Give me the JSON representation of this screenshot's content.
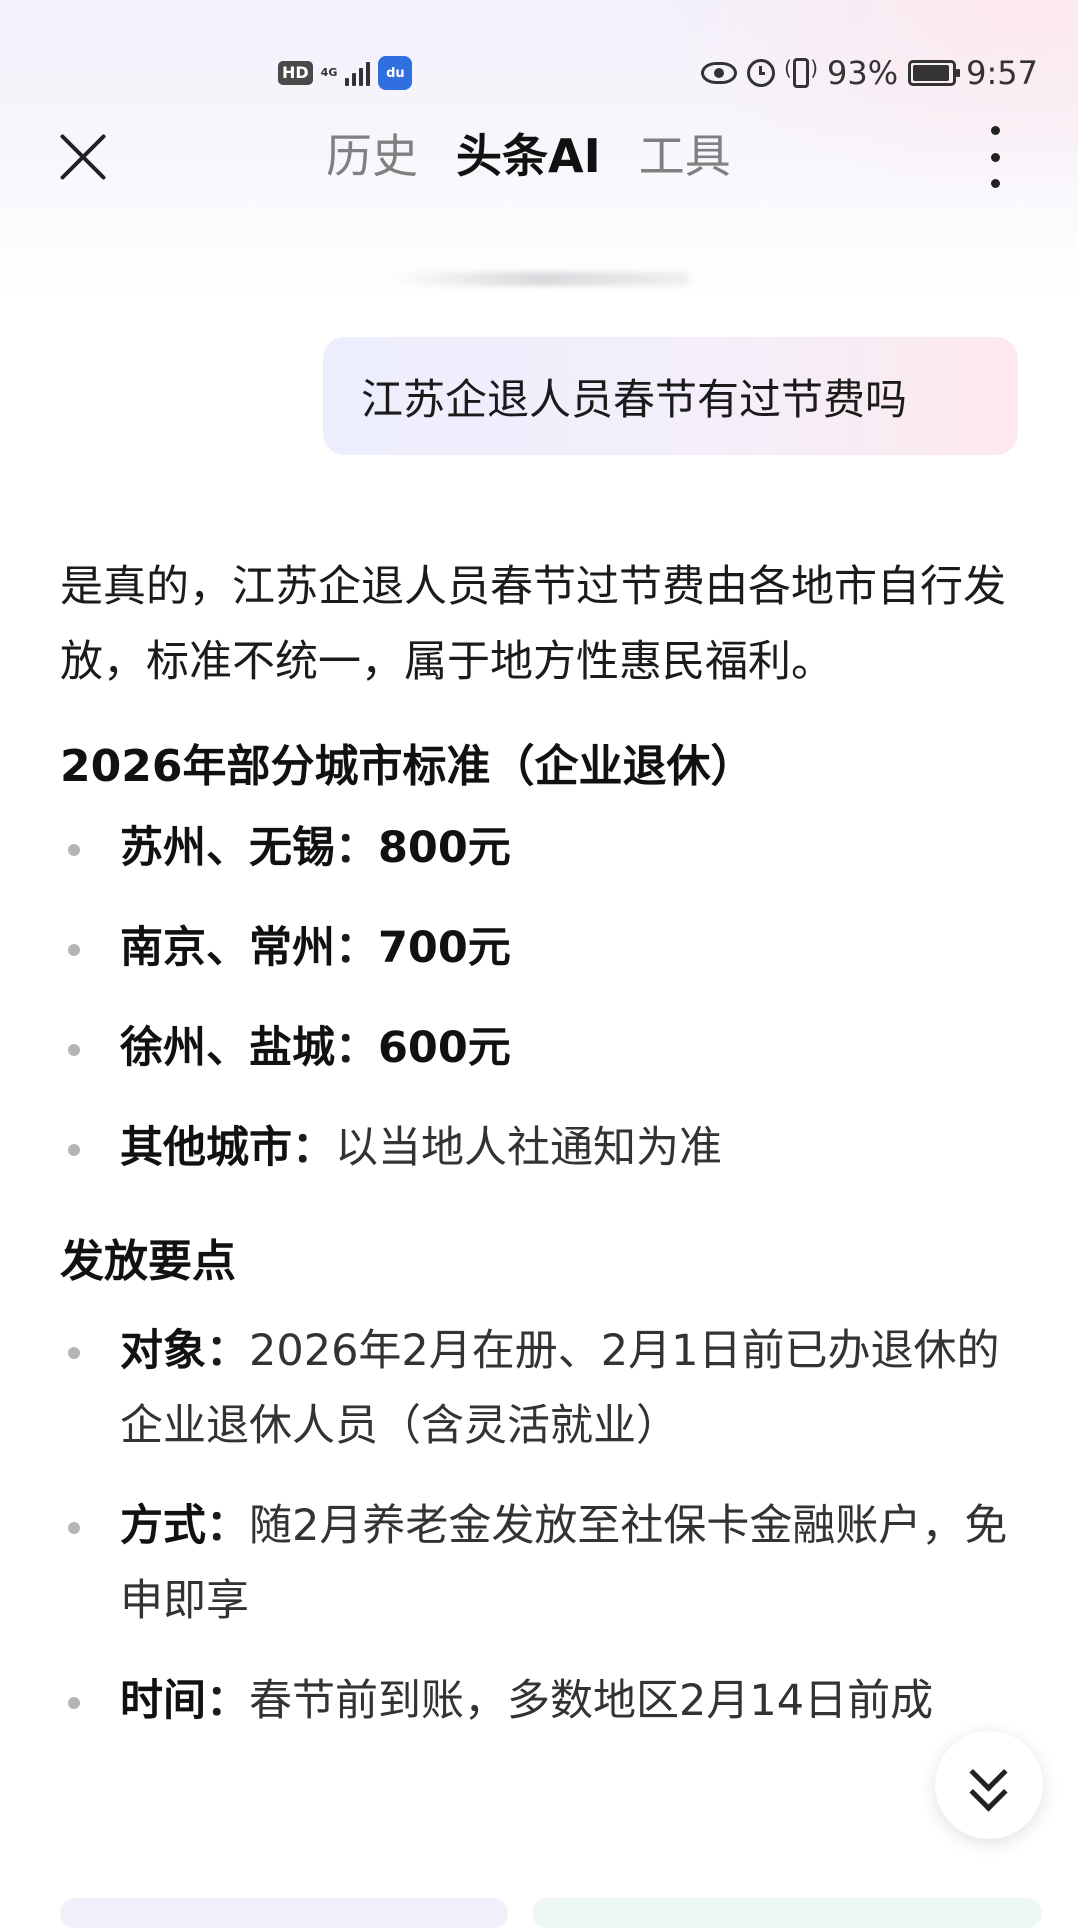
{
  "status_bar": {
    "hd": "HD",
    "network": "4G",
    "battery_percent": "93%",
    "time": "9:57",
    "icons": [
      "hd-icon",
      "signal-icon",
      "baidu-icon",
      "eye-icon",
      "alarm-icon",
      "vibrate-icon",
      "battery-icon"
    ]
  },
  "nav": {
    "tabs": [
      {
        "label": "历史",
        "active": false
      },
      {
        "label": "头条AI",
        "active": true
      },
      {
        "label": "工具",
        "active": false
      }
    ]
  },
  "chat": {
    "user_message": "江苏企退人员春节有过节费吗",
    "answer": {
      "intro": "是真的，江苏企退人员春节过节费由各地市自行发放，标准不统一，属于地方性惠民福利。",
      "section1_title": "2026年部分城市标准（企业退休）",
      "section1_items": [
        {
          "key": "苏州、无锡",
          "sep": "：",
          "value": "800元"
        },
        {
          "key": "南京、常州",
          "sep": "：",
          "value": "700元"
        },
        {
          "key": "徐州、盐城",
          "sep": "：",
          "value": "600元"
        },
        {
          "key": "其他城市",
          "sep": "：",
          "value": "以当地人社通知为准"
        }
      ],
      "section2_title": "发放要点",
      "section2_items": [
        {
          "key": "对象",
          "sep": "：",
          "value": "2026年2月在册、2月1日前已办退休的企业退休人员（含灵活就业）"
        },
        {
          "key": "方式",
          "sep": "：",
          "value": "随2月养老金发放至社保卡金融账户，免申即享"
        },
        {
          "key": "时间",
          "sep": "：",
          "value": "春节前到账，多数地区2月14日前成"
        }
      ]
    }
  },
  "colors": {
    "bubble_start": "#eceefd",
    "bubble_end": "#fde9ee",
    "bullet_dot": "#b5b5b5",
    "tab_inactive": "#808080"
  }
}
